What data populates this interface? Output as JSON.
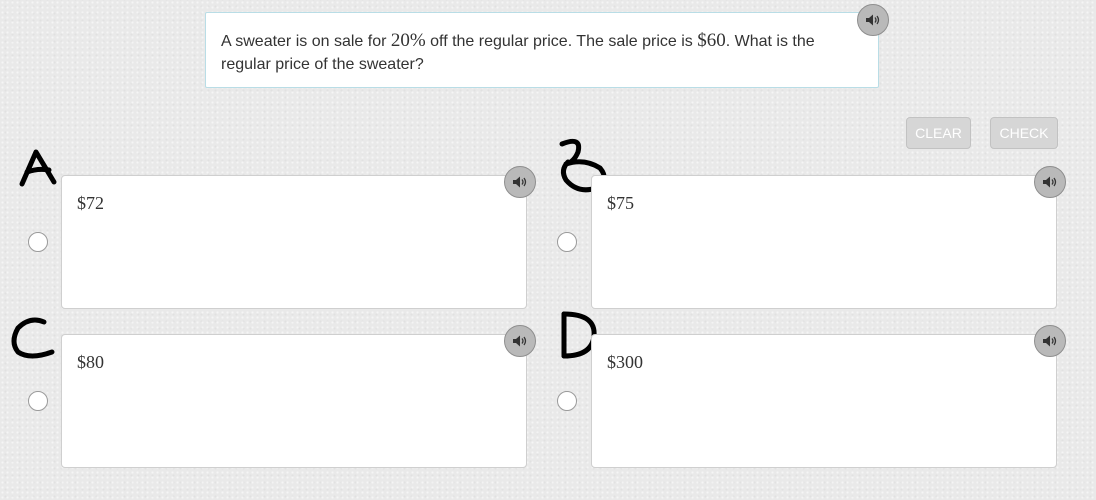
{
  "question": {
    "text_before_percent": "A sweater is on sale for ",
    "percent": "20%",
    "text_before_price": " off the regular price. The sale price is ",
    "sale_price": "$60",
    "text_after_price": ". What is the regular price of the sweater?"
  },
  "buttons": {
    "clear_label": "CLEAR",
    "check_label": "CHECK"
  },
  "choices": [
    {
      "letter": "A",
      "value": "$72"
    },
    {
      "letter": "B",
      "value": "$75"
    },
    {
      "letter": "C",
      "value": "$80"
    },
    {
      "letter": "D",
      "value": "$300"
    }
  ],
  "icons": {
    "speaker": "speaker-icon",
    "radio": "radio-button"
  },
  "colors": {
    "background": "#e9e9e9",
    "question_border": "#b9dde6",
    "button_disabled": "#d6d6d6",
    "speaker_fill": "#b9b9b9",
    "handwriting": "#000000"
  }
}
